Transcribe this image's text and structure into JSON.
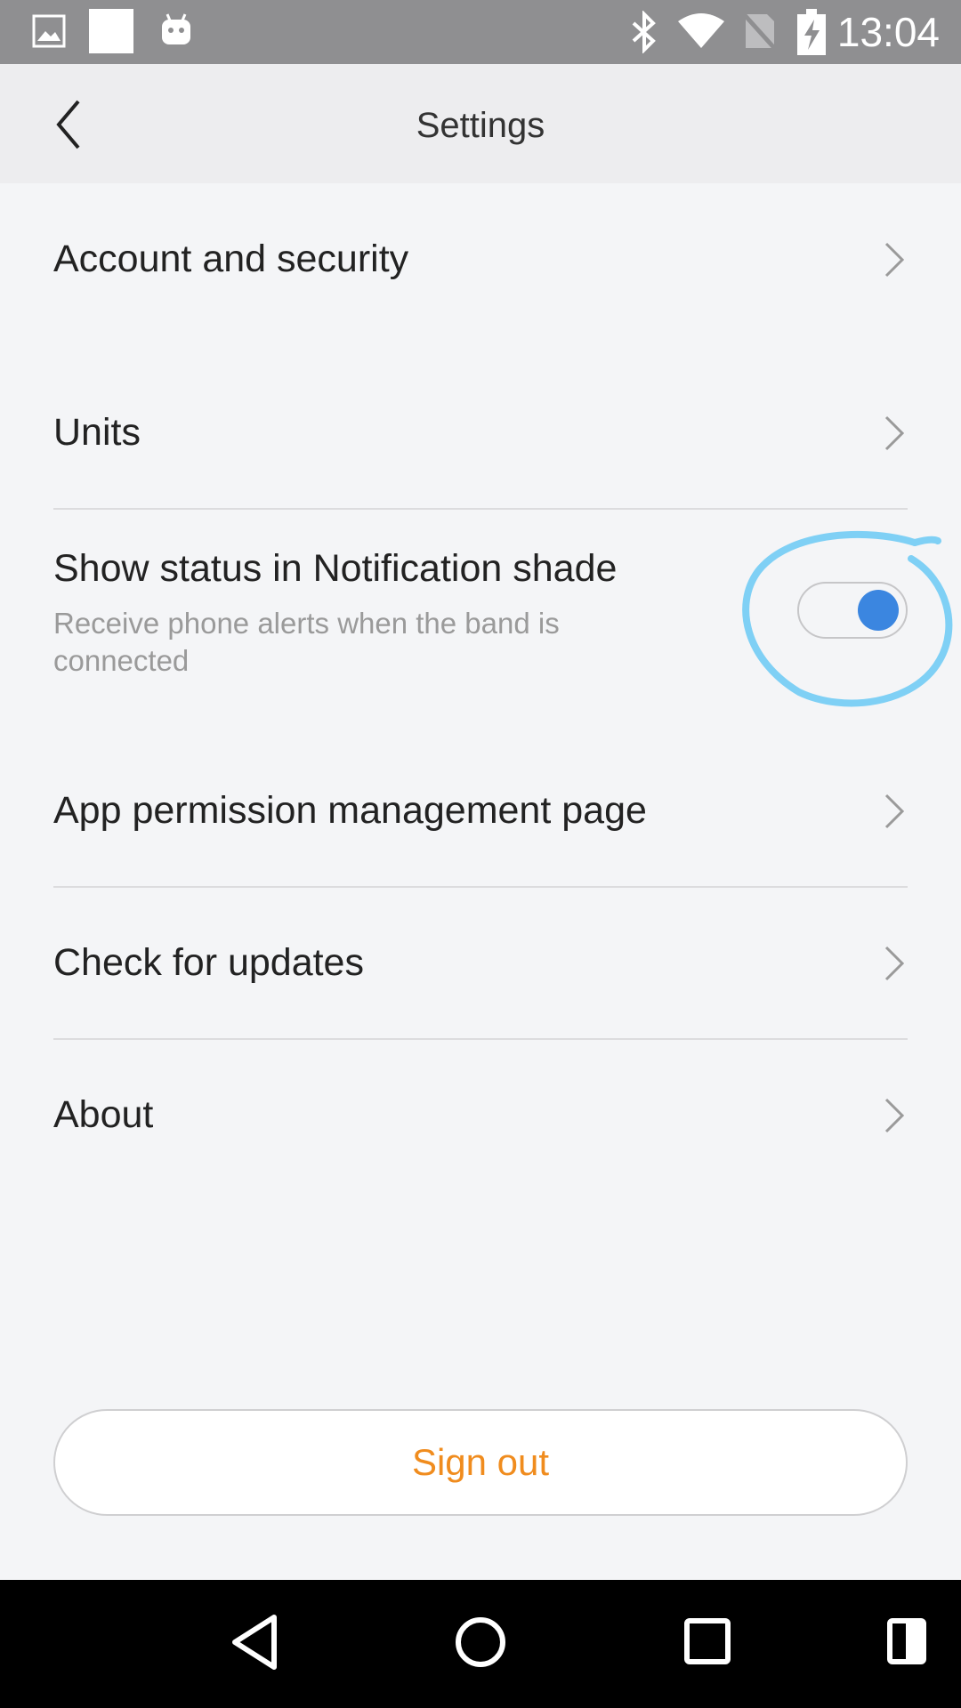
{
  "status_bar": {
    "time": "13:04",
    "icons": [
      "image-icon",
      "white-square-icon",
      "android-icon",
      "bluetooth-icon",
      "wifi-icon",
      "no-sim-icon",
      "battery-charging-icon"
    ]
  },
  "header": {
    "title": "Settings",
    "back_icon": "chevron-left-icon"
  },
  "rows": {
    "account": "Account and security",
    "units": "Units",
    "notification_title": "Show status in Notification shade",
    "notification_subtitle": "Receive phone alerts when the band is connected",
    "notification_enabled": true,
    "permissions": "App permission management page",
    "updates": "Check for updates",
    "about": "About"
  },
  "sign_out": "Sign out",
  "colors": {
    "accent_orange": "#f08c1e",
    "toggle_blue": "#3b86e0",
    "annotation_blue": "#7fd0f5"
  },
  "nav_bar": {
    "icons": [
      "back-triangle-icon",
      "home-circle-icon",
      "recents-square-icon",
      "split-screen-icon"
    ]
  }
}
